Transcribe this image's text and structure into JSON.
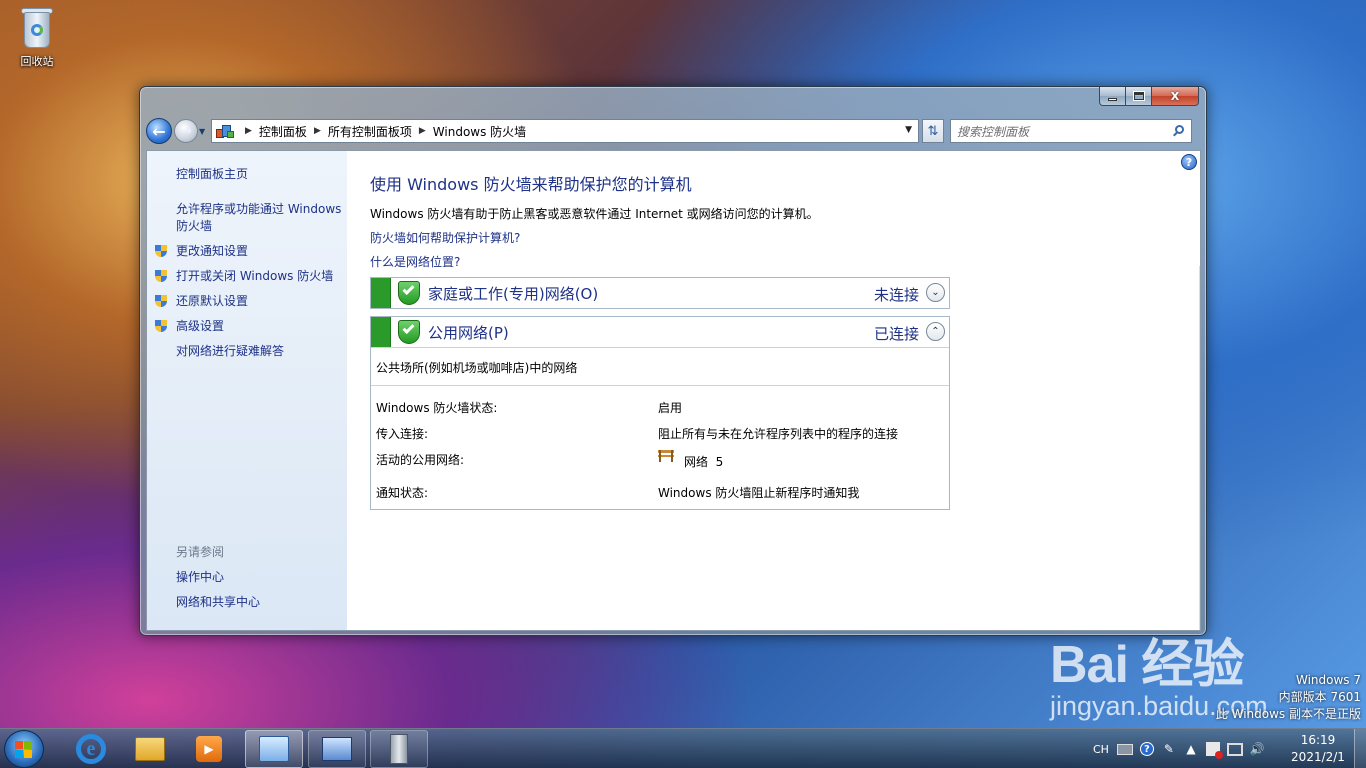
{
  "desktop": {
    "recycle_bin_label": "回收站"
  },
  "window": {
    "caption": {
      "minimize": "",
      "maximize": "",
      "close": "X"
    },
    "address": {
      "breadcrumbs": [
        "控制面板",
        "所有控制面板项",
        "Windows 防火墙"
      ]
    },
    "search": {
      "placeholder": "搜索控制面板"
    }
  },
  "left_pane": {
    "links": [
      {
        "label": "控制面板主页",
        "shield": false
      },
      {
        "label": "允许程序或功能通过 Windows 防火墙",
        "shield": false
      },
      {
        "label": "更改通知设置",
        "shield": true
      },
      {
        "label": "打开或关闭 Windows 防火墙",
        "shield": true
      },
      {
        "label": "还原默认设置",
        "shield": true
      },
      {
        "label": "高级设置",
        "shield": true
      },
      {
        "label": "对网络进行疑难解答",
        "shield": false
      }
    ],
    "see_also_title": "另请参阅",
    "see_also": [
      "操作中心",
      "网络和共享中心"
    ]
  },
  "main": {
    "title": "使用 Windows 防火墙来帮助保护您的计算机",
    "description": "Windows 防火墙有助于防止黑客或恶意软件通过 Internet 或网络访问您的计算机。",
    "links": [
      "防火墙如何帮助保护计算机?",
      "什么是网络位置?"
    ],
    "networks": [
      {
        "name": "家庭或工作(专用)网络(O)",
        "status": "未连接",
        "expanded": false
      },
      {
        "name": "公用网络(P)",
        "status": "已连接",
        "expanded": true,
        "description": "公共场所(例如机场或咖啡店)中的网络",
        "details": [
          {
            "label": "Windows 防火墙状态:",
            "value": "启用"
          },
          {
            "label": "传入连接:",
            "value": "阻止所有与未在允许程序列表中的程序的连接"
          },
          {
            "label": "活动的公用网络:",
            "value": "网络  5"
          },
          {
            "label": "通知状态:",
            "value": "Windows 防火墙阻止新程序时通知我"
          }
        ]
      }
    ]
  },
  "overlay": {
    "watermark_logo": "Bai 经验",
    "watermark_url": "jingyan.baidu.com",
    "build_line1": "Windows 7",
    "build_line2": "内部版本 7601",
    "build_line3": "此 Windows 副本不是正版"
  },
  "taskbar": {
    "tray_lang": "CH",
    "time": "16:19",
    "date": "2021/2/1"
  },
  "colors": {
    "link": "#1e3287",
    "status_green": "#2a9a2a"
  }
}
